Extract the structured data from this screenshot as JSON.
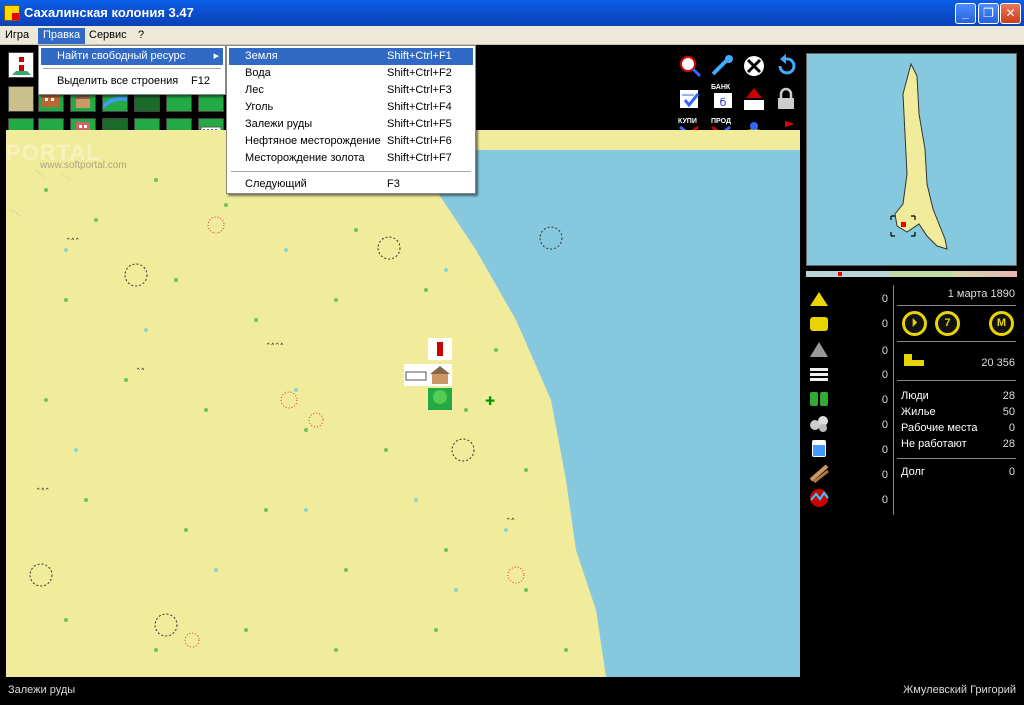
{
  "window": {
    "title": "Сахалинская колония 3.47",
    "min_label": "_",
    "max_label": "❐",
    "close_label": "✕"
  },
  "menubar": {
    "items": [
      "Игра",
      "Правка",
      "Сервис",
      "?"
    ]
  },
  "edit_menu": {
    "items": [
      {
        "label": "Найти свободный ресурс",
        "shortcut": "▸"
      },
      {
        "label": "Выделить все строения",
        "shortcut": "F12"
      }
    ]
  },
  "resource_menu": {
    "items": [
      {
        "label": "Земля",
        "shortcut": "Shift+Ctrl+F1"
      },
      {
        "label": "Вода",
        "shortcut": "Shift+Ctrl+F2"
      },
      {
        "label": "Лес",
        "shortcut": "Shift+Ctrl+F3"
      },
      {
        "label": "Уголь",
        "shortcut": "Shift+Ctrl+F4"
      },
      {
        "label": "Залежи руды",
        "shortcut": "Shift+Ctrl+F5"
      },
      {
        "label": "Нефтяное месторождение",
        "shortcut": "Shift+Ctrl+F6"
      },
      {
        "label": "Месторождение золота",
        "shortcut": "Shift+Ctrl+F7"
      }
    ],
    "next": {
      "label": "Следующий",
      "shortcut": "F3"
    }
  },
  "toolbar": {
    "bank_label": "БАНК",
    "buy_label": "КУПИ",
    "sell_label": "ПРОД"
  },
  "colors": {
    "land": "#f1ec9c",
    "water": "#86c8de",
    "menu_highlight": "#316ac5"
  },
  "resources": [
    {
      "name": "gold-sand-icon",
      "value": "0"
    },
    {
      "name": "hay-icon",
      "value": "0"
    },
    {
      "name": "coal-icon",
      "value": "0"
    },
    {
      "name": "planks-icon",
      "value": "0"
    },
    {
      "name": "barrels-icon",
      "value": "0"
    },
    {
      "name": "stones-icon",
      "value": "0"
    },
    {
      "name": "water-tank-icon",
      "value": "0"
    },
    {
      "name": "logs-icon",
      "value": "0"
    },
    {
      "name": "oil-icon",
      "value": "0"
    }
  ],
  "stats": {
    "date": "1 марта 1890",
    "money": "20 356",
    "people_label": "Люди",
    "people": "28",
    "housing_label": "Жилье",
    "housing": "50",
    "jobs_label": "Рабочие места",
    "jobs": "0",
    "unemployed_label": "Не работают",
    "unemployed": "28",
    "debt_label": "Долг",
    "debt": "0"
  },
  "speed_buttons": [
    "⏵",
    "7",
    "M"
  ],
  "status": {
    "left": "Залежи руды",
    "right": "Жмулевский Григорий"
  },
  "watermark": {
    "logo": "PORTAL",
    "url": "www.softportal.com"
  }
}
